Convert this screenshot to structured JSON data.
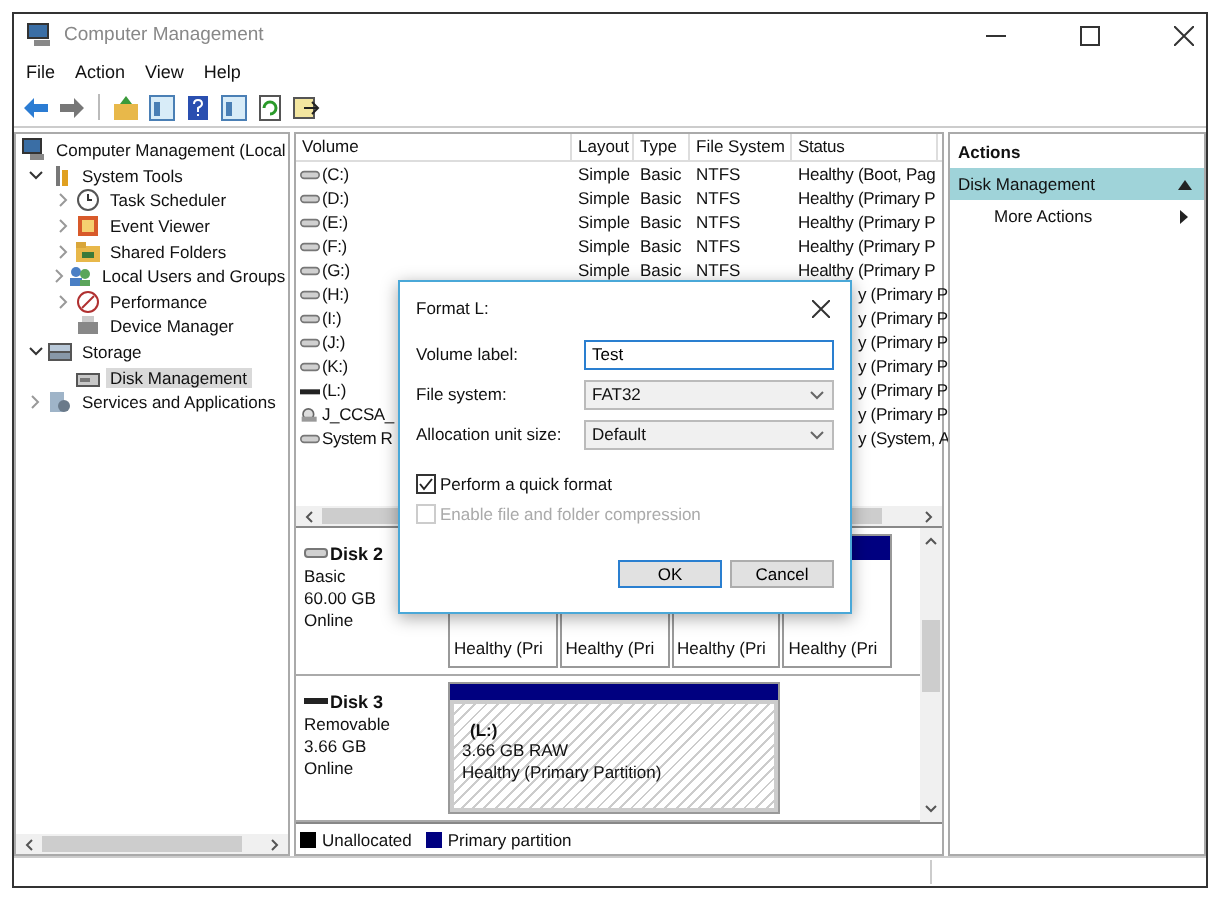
{
  "window": {
    "title": "Computer Management"
  },
  "menu": [
    "File",
    "Action",
    "View",
    "Help"
  ],
  "toolbar": [
    {
      "kind": "back"
    },
    {
      "kind": "forward"
    },
    {
      "kind": "sep"
    },
    {
      "kind": "up"
    },
    {
      "kind": "tree"
    },
    {
      "kind": "help"
    },
    {
      "kind": "pane"
    },
    {
      "kind": "refresh"
    },
    {
      "kind": "export"
    }
  ],
  "tree": [
    {
      "label": "Computer Management (Local",
      "selected": false,
      "children": [
        {
          "label": "System Tools",
          "expanded": true,
          "selected": false,
          "children": [
            {
              "label": "Task Scheduler",
              "expanded": false,
              "selected": false
            },
            {
              "label": "Event Viewer",
              "expanded": false,
              "selected": false
            },
            {
              "label": "Shared Folders",
              "expanded": false,
              "selected": false
            },
            {
              "label": "Local Users and Groups",
              "expanded": false,
              "selected": false
            },
            {
              "label": "Performance",
              "expanded": false,
              "selected": false
            },
            {
              "label": "Device Manager",
              "selected": false
            }
          ]
        },
        {
          "label": "Storage",
          "expanded": true,
          "selected": false,
          "children": [
            {
              "label": "Disk Management",
              "selected": true
            }
          ]
        },
        {
          "label": "Services and Applications",
          "expanded": false,
          "selected": false
        }
      ]
    }
  ],
  "table": {
    "columns": [
      "Volume",
      "Layout",
      "Type",
      "File System",
      "Status"
    ],
    "rows": [
      {
        "kind": "drive",
        "volume": "(C:)",
        "layout": "Simple",
        "type": "Basic",
        "file_system": "NTFS",
        "status": "Healthy (Boot, Pag"
      },
      {
        "kind": "drive",
        "volume": "(D:)",
        "layout": "Simple",
        "type": "Basic",
        "file_system": "NTFS",
        "status": "Healthy (Primary P"
      },
      {
        "kind": "drive",
        "volume": "(E:)",
        "layout": "Simple",
        "type": "Basic",
        "file_system": "NTFS",
        "status": "Healthy (Primary P"
      },
      {
        "kind": "drive",
        "volume": "(F:)",
        "layout": "Simple",
        "type": "Basic",
        "file_system": "NTFS",
        "status": "Healthy (Primary P"
      },
      {
        "kind": "drive",
        "volume": "(G:)",
        "layout": "Simple",
        "type": "Basic",
        "file_system": "NTFS",
        "status": "Healthy (Primary P"
      },
      {
        "kind": "drive",
        "volume": "(H:)",
        "status": "y (Primary P"
      },
      {
        "kind": "drive",
        "volume": "(I:)",
        "status": "y (Primary P"
      },
      {
        "kind": "drive",
        "volume": "(J:)",
        "status": "y (Primary P"
      },
      {
        "kind": "drive",
        "volume": "(K:)",
        "status": "y (Primary P"
      },
      {
        "kind": "removable",
        "volume": "(L:)",
        "status": "y (Primary P"
      },
      {
        "kind": "disc",
        "volume": "J_CCSA_",
        "status": "y (Primary P"
      },
      {
        "kind": "drive",
        "volume": "System R",
        "status": "y (System, A"
      }
    ]
  },
  "disks": [
    {
      "kind": "basic",
      "name": "Disk 2",
      "lines": [
        "Basic",
        "60.00 GB",
        "Online"
      ],
      "partitions": [
        {
          "status": "Healthy (Pri",
          "selected": false
        },
        {
          "status": "Healthy (Pri",
          "selected": false
        },
        {
          "status": "Healthy (Pri",
          "selected": false
        },
        {
          "status": "Healthy (Pri",
          "selected": false
        }
      ]
    },
    {
      "kind": "removable",
      "name": "Disk 3",
      "lines": [
        "Removable",
        "3.66 GB",
        "Online"
      ],
      "partitions": [
        {
          "name": "(L:)",
          "size": "3.66 GB RAW",
          "status": "Healthy (Primary Partition)",
          "selected": true
        }
      ]
    }
  ],
  "legend": [
    {
      "label": "Unallocated",
      "color": "#000000"
    },
    {
      "label": "Primary partition",
      "color": "#000080"
    }
  ],
  "actions": {
    "title": "Actions",
    "section": "Disk Management",
    "items": [
      "More Actions"
    ]
  },
  "dialog": {
    "title": "Format L:",
    "fields": [
      {
        "kind": "text",
        "label": "Volume label:",
        "value": "Test"
      },
      {
        "kind": "select",
        "label": "File system:",
        "value": "FAT32"
      },
      {
        "kind": "select",
        "label": "Allocation unit size:",
        "value": "Default"
      }
    ],
    "checkboxes": [
      {
        "label": "Perform a quick format",
        "checked": true,
        "disabled": false
      },
      {
        "label": "Enable file and folder compression",
        "checked": false,
        "disabled": true
      }
    ],
    "buttons": [
      {
        "label": "OK",
        "default": true
      },
      {
        "label": "Cancel",
        "default": false
      }
    ]
  }
}
